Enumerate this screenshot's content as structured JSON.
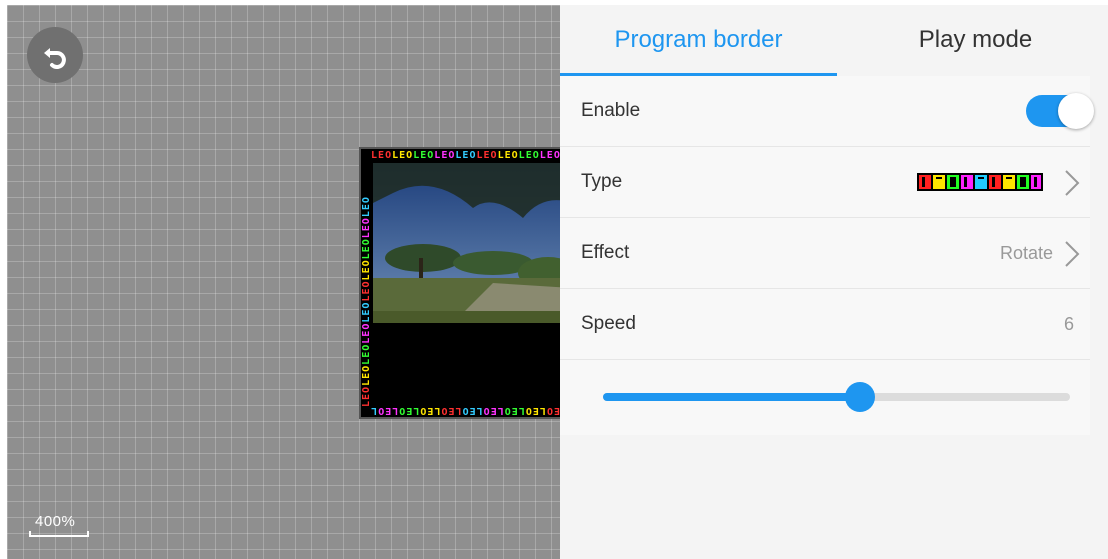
{
  "canvas": {
    "zoom_label": "400%",
    "border_text": "LEOLEOLEOLEOLEOLEOLEOLEOLEOLEO"
  },
  "tabs": [
    {
      "label": "Program border",
      "active": true
    },
    {
      "label": "Play mode",
      "active": false
    }
  ],
  "settings": {
    "enable_label": "Enable",
    "enable_on": true,
    "type_label": "Type",
    "type_preview_text": "LEOLEOLEO",
    "effect_label": "Effect",
    "effect_value": "Rotate",
    "speed_label": "Speed",
    "speed_value": "6",
    "speed_fraction": 0.55
  },
  "colors": {
    "accent": "#1e96f0",
    "canvas_bg": "#8f8f8f"
  },
  "icons": {
    "undo": "undo-icon",
    "chevron": "chevron-right-icon"
  }
}
